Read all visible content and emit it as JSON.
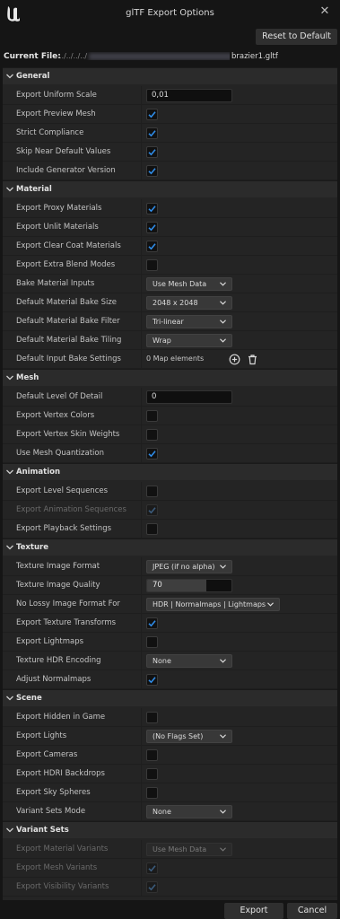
{
  "window": {
    "title": "glTF Export Options",
    "close_glyph": "✕"
  },
  "toolbar": {
    "reset_label": "Reset to Default"
  },
  "file": {
    "label": "Current File:",
    "path_prefix": "../../../../",
    "name": "brazier1.gltf"
  },
  "footer": {
    "export_label": "Export",
    "cancel_label": "Cancel"
  },
  "colors": {
    "accent_check": "#2f8ce8",
    "panel_bg": "#242424",
    "section_bg": "#2b2b2b"
  },
  "icons": {
    "section_toggle": "chevron-down-icon",
    "check": "checkmark-icon",
    "add": "add-circle-icon",
    "delete": "trash-icon",
    "dropdown": "chevron-down-icon"
  },
  "sections": [
    {
      "title": "General",
      "rows": [
        {
          "label": "Export Uniform Scale",
          "type": "number",
          "value": "0,01"
        },
        {
          "label": "Export Preview Mesh",
          "type": "checkbox",
          "checked": true
        },
        {
          "label": "Strict Compliance",
          "type": "checkbox",
          "checked": true
        },
        {
          "label": "Skip Near Default Values",
          "type": "checkbox",
          "checked": true
        },
        {
          "label": "Include Generator Version",
          "type": "checkbox",
          "checked": true
        }
      ]
    },
    {
      "title": "Material",
      "rows": [
        {
          "label": "Export Proxy Materials",
          "type": "checkbox",
          "checked": true
        },
        {
          "label": "Export Unlit Materials",
          "type": "checkbox",
          "checked": true
        },
        {
          "label": "Export Clear Coat Materials",
          "type": "checkbox",
          "checked": true
        },
        {
          "label": "Export Extra Blend Modes",
          "type": "checkbox",
          "checked": false
        },
        {
          "label": "Bake Material Inputs",
          "type": "dropdown",
          "value": "Use Mesh Data"
        },
        {
          "label": "Default Material Bake Size",
          "type": "dropdown",
          "value": "2048 x 2048"
        },
        {
          "label": "Default Material Bake Filter",
          "type": "dropdown",
          "value": "Tri-linear"
        },
        {
          "label": "Default Material Bake Tiling",
          "type": "dropdown",
          "value": "Wrap"
        },
        {
          "label": "Default Input Bake Settings",
          "type": "map",
          "value": "0 Map elements"
        }
      ]
    },
    {
      "title": "Mesh",
      "rows": [
        {
          "label": "Default Level Of Detail",
          "type": "number",
          "value": "0"
        },
        {
          "label": "Export Vertex Colors",
          "type": "checkbox",
          "checked": false
        },
        {
          "label": "Export Vertex Skin Weights",
          "type": "checkbox",
          "checked": false
        },
        {
          "label": "Use Mesh Quantization",
          "type": "checkbox",
          "checked": true
        }
      ]
    },
    {
      "title": "Animation",
      "rows": [
        {
          "label": "Export Level Sequences",
          "type": "checkbox",
          "checked": false
        },
        {
          "label": "Export Animation Sequences",
          "type": "checkbox",
          "checked": true,
          "disabled": true
        },
        {
          "label": "Export Playback Settings",
          "type": "checkbox",
          "checked": false
        }
      ]
    },
    {
      "title": "Texture",
      "rows": [
        {
          "label": "Texture Image Format",
          "type": "dropdown",
          "value": "JPEG (if no alpha)"
        },
        {
          "label": "Texture Image Quality",
          "type": "slider",
          "value": "70",
          "fraction": 0.7
        },
        {
          "label": "No Lossy Image Format For",
          "type": "dropdown",
          "value": "HDR | Normalmaps | Lightmaps"
        },
        {
          "label": "Export Texture Transforms",
          "type": "checkbox",
          "checked": true
        },
        {
          "label": "Export Lightmaps",
          "type": "checkbox",
          "checked": false
        },
        {
          "label": "Texture HDR Encoding",
          "type": "dropdown",
          "value": "None"
        },
        {
          "label": "Adjust Normalmaps",
          "type": "checkbox",
          "checked": true
        }
      ]
    },
    {
      "title": "Scene",
      "rows": [
        {
          "label": "Export Hidden in Game",
          "type": "checkbox",
          "checked": false
        },
        {
          "label": "Export Lights",
          "type": "dropdown",
          "value": "(No Flags Set)"
        },
        {
          "label": "Export Cameras",
          "type": "checkbox",
          "checked": false
        },
        {
          "label": "Export HDRI Backdrops",
          "type": "checkbox",
          "checked": false
        },
        {
          "label": "Export Sky Spheres",
          "type": "checkbox",
          "checked": false
        },
        {
          "label": "Variant Sets Mode",
          "type": "dropdown",
          "value": "None"
        }
      ]
    },
    {
      "title": "Variant Sets",
      "rows": [
        {
          "label": "Export Material Variants",
          "type": "dropdown",
          "value": "Use Mesh Data",
          "disabled": true
        },
        {
          "label": "Export Mesh Variants",
          "type": "checkbox",
          "checked": true,
          "disabled": true
        },
        {
          "label": "Export Visibility Variants",
          "type": "checkbox",
          "checked": true,
          "disabled": true
        }
      ]
    }
  ]
}
